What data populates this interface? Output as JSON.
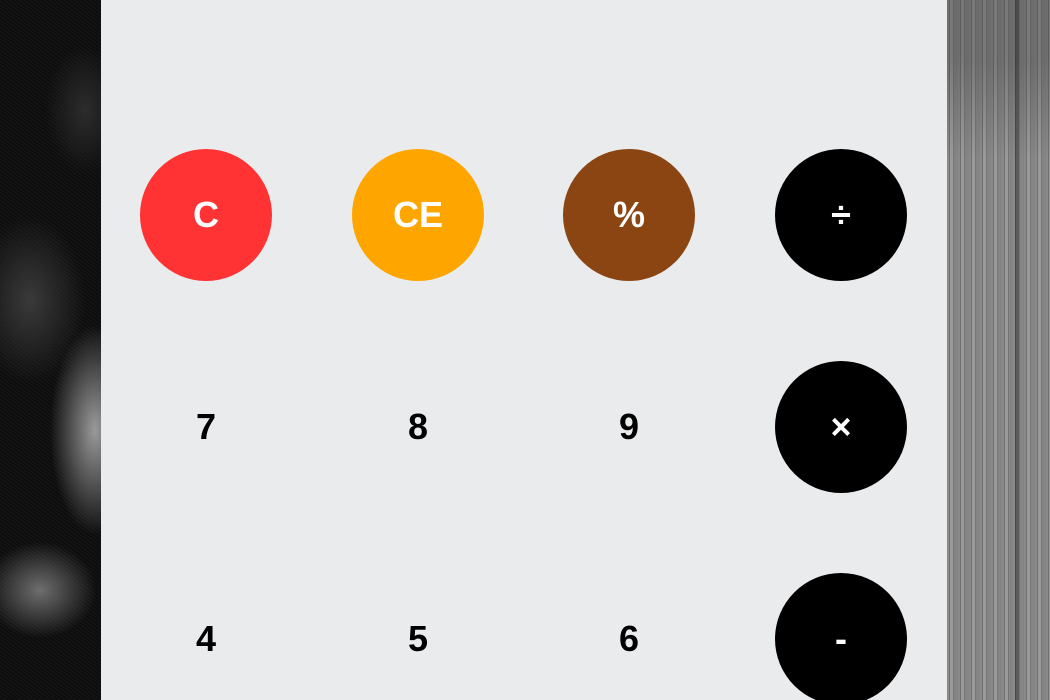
{
  "keypad": {
    "row1": {
      "clear": "C",
      "clear_entry": "CE",
      "percent": "%",
      "divide": "÷"
    },
    "row2": {
      "seven": "7",
      "eight": "8",
      "nine": "9",
      "multiply": "×"
    },
    "row3": {
      "four": "4",
      "five": "5",
      "six": "6",
      "subtract": "-"
    }
  },
  "colors": {
    "clear": "#ff3333",
    "clear_entry": "#ffa500",
    "percent": "#8b4513",
    "operator": "#000000",
    "panel": "#eaebed"
  }
}
